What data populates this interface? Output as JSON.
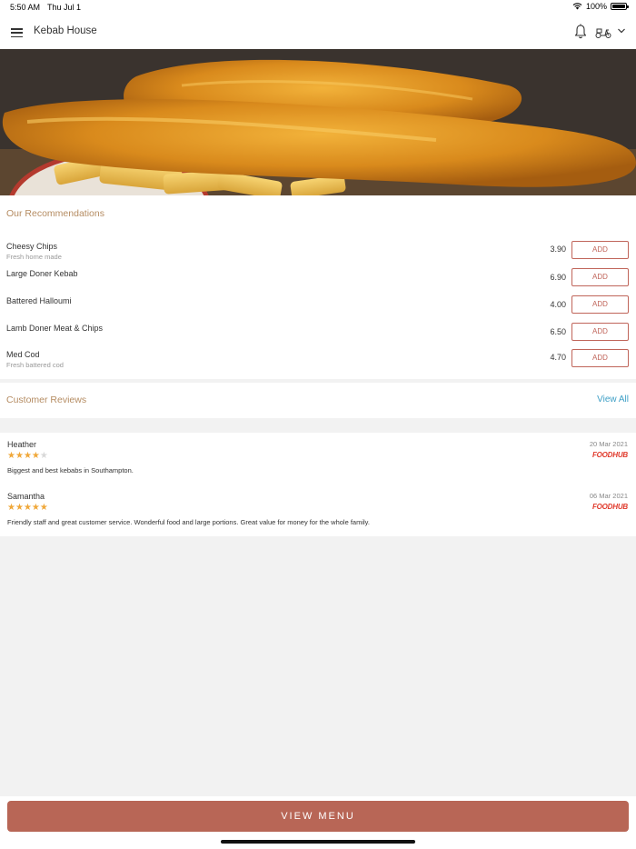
{
  "status_bar": {
    "time": "5:50 AM",
    "date": "Thu Jul 1",
    "battery_percent": "100%"
  },
  "header": {
    "title": "Kebab House",
    "icons": [
      "menu-icon",
      "bell-icon",
      "scooter-icon",
      "chevron-down-icon"
    ]
  },
  "recommendations": {
    "title": "Our Recommendations",
    "add_label": "ADD",
    "items": [
      {
        "name": "Cheesy Chips",
        "description": "Fresh home made",
        "price": "3.90"
      },
      {
        "name": "Large Doner Kebab",
        "description": "",
        "price": "6.90"
      },
      {
        "name": "Battered Halloumi",
        "description": "",
        "price": "4.00"
      },
      {
        "name": "Lamb Doner Meat & Chips",
        "description": "",
        "price": "6.50"
      },
      {
        "name": "Med Cod",
        "description": "Fresh battered cod",
        "price": "4.70"
      }
    ]
  },
  "reviews": {
    "title": "Customer Reviews",
    "view_all": "View All",
    "items": [
      {
        "name": "Heather",
        "rating": 4,
        "max_rating": 5,
        "date": "20 Mar 2021",
        "source": "FOODHUB",
        "text": "Biggest and best kebabs in Southampton."
      },
      {
        "name": "Samantha",
        "rating": 5,
        "max_rating": 5,
        "date": "06 Mar 2021",
        "source": "FOODHUB",
        "text": "Friendly staff and great customer service. Wonderful food and large portions. Great value for money for the whole family."
      }
    ]
  },
  "footer": {
    "view_menu": "VIEW MENU"
  },
  "colors": {
    "accent": "#b86656",
    "add_border": "#c0655a",
    "section_title": "#b58c62",
    "link": "#3d9fc6",
    "star": "#f0a83a",
    "brand_red": "#e03a2c"
  }
}
